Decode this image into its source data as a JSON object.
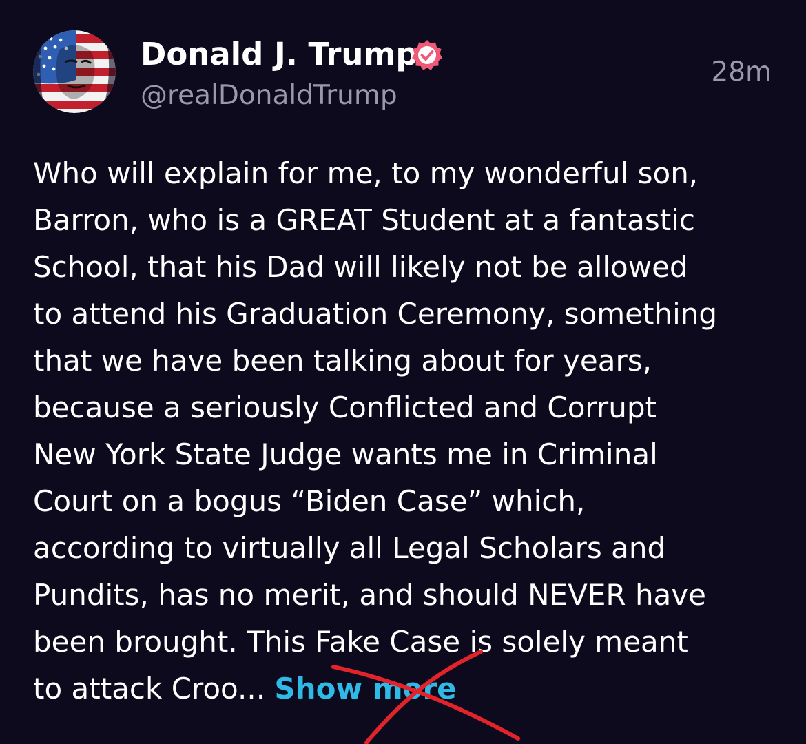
{
  "post": {
    "author_name": "Donald J. Trump",
    "handle": "@realDonaldTrump",
    "timestamp": "28m",
    "lines": [
      "Who will explain for me, to my wonderful son,",
      "Barron, who is a GREAT Student at a fantastic",
      "School, that his Dad will likely not be allowed",
      "to attend his Graduation Ceremony, something",
      "that we have been talking about for years,",
      "because a seriously Conflicted and Corrupt",
      "New York State Judge wants me in Criminal",
      "Court on a bogus “Biden Case” which,",
      "according to virtually all Legal Scholars and",
      "Pundits, has no merit, and should NEVER have",
      "been brought. This Fake Case is solely meant"
    ],
    "last_line_text": "to attack Croo... ",
    "show_more_label": "Show more"
  },
  "icons": {
    "verified": "verified-badge-icon",
    "avatar": "avatar-flag-portrait"
  },
  "colors": {
    "background": "#0c0a1c",
    "text": "#ffffff",
    "muted": "#9c98ac",
    "link": "#2fb9e7",
    "verified": "#ef5a78",
    "annotation": "#e2232b"
  }
}
